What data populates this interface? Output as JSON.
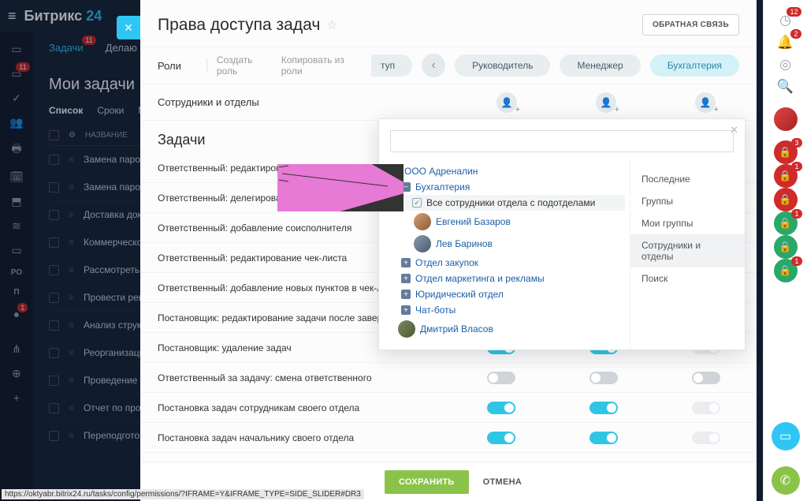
{
  "bg": {
    "logo1": "Битрикс",
    "logo2": "24",
    "tabs": [
      {
        "label": "Задачи",
        "badge": "11"
      },
      {
        "label": "Делаю"
      }
    ],
    "title": "Мои задачи",
    "filters": [
      "Список",
      "Сроки",
      "Мой"
    ],
    "head_col": "НАЗВАНИЕ",
    "rows": [
      "Замена парол",
      "Замена парол",
      "Доставка доку",
      "Коммерческое",
      "Рассмотреть",
      "Провести рев",
      "Анализ структ",
      "Реорганизаци",
      "Проведение о",
      "Отчет по прод",
      "Переподготов"
    ],
    "left_icons": [
      {
        "g": "▭",
        "b": ""
      },
      {
        "g": "▭",
        "b": "11"
      },
      {
        "g": "✓",
        "b": ""
      },
      {
        "g": "👥",
        "b": ""
      },
      {
        "g": "🖶",
        "b": ""
      },
      {
        "g": "🗓",
        "b": ""
      },
      {
        "g": "⬒",
        "b": ""
      },
      {
        "g": "≋",
        "b": ""
      },
      {
        "g": "▭",
        "b": ""
      },
      {
        "t": "PO"
      },
      {
        "t": "П"
      },
      {
        "g": "●",
        "b": "1"
      },
      {
        "g": "",
        "b": ""
      },
      {
        "g": "⋔",
        "b": ""
      },
      {
        "g": "⊕",
        "b": ""
      },
      {
        "g": "+",
        "b": ""
      }
    ],
    "url": "https://oktyabr.bitrix24.ru/tasks/config/permissions/?IFRAME=Y&IFRAME_TYPE=SIDE_SLIDER#DR3"
  },
  "panel": {
    "title": "Права доступа задач",
    "feedback": "ОБРАТНАЯ СВЯЗЬ",
    "roles_label": "Роли",
    "create_role": "Создать роль",
    "copy_role": "Копировать из роли",
    "role_half": "туп",
    "roles": [
      "Руководитель",
      "Менеджер",
      "Бухгалтерия"
    ],
    "employees_label": "Сотрудники и отделы",
    "section": "Задачи",
    "perm_rows": [
      {
        "n": "Ответственный: редактирование задачи",
        "t": []
      },
      {
        "n": "Ответственный: делегирование",
        "t": []
      },
      {
        "n": "Ответственный: добавление соисполнителя",
        "t": []
      },
      {
        "n": "Ответственный: редактирование чек-листа",
        "t": []
      },
      {
        "n": "Ответственный: добавление новых пунктов в чек-листы",
        "t": []
      },
      {
        "n": "Постановщик: редактирование задачи после заверше...",
        "t": []
      },
      {
        "n": "Постановщик: удаление задач",
        "t": [
          "on",
          "on",
          "dis"
        ]
      },
      {
        "n": "Ответственный за задачу: смена ответственного",
        "t": [
          "off",
          "off",
          "off"
        ]
      },
      {
        "n": "Постановка задач сотрудникам своего отдела",
        "t": [
          "on",
          "on",
          "dis"
        ]
      },
      {
        "n": "Постановка задач начальнику своего отдела",
        "t": [
          "on",
          "on",
          "dis"
        ]
      }
    ],
    "save": "СОХРАНИТЬ",
    "cancel": "ОТМЕНА"
  },
  "popup": {
    "root": "ООО Адреналин",
    "dept": "Бухгалтерия",
    "all_sub": "Все сотрудники отдела с подотделами",
    "people": [
      "Евгений Базаров",
      "Лев Баринов"
    ],
    "other_depts": [
      "Отдел закупок",
      "Отдел маркетинга и рекламы",
      "Юридический отдел",
      "Чат-боты"
    ],
    "loose_person": "Дмитрий Власов",
    "tabs": [
      "Последние",
      "Группы",
      "Мои группы",
      "Сотрудники и отделы",
      "Поиск"
    ]
  },
  "rsb": {
    "icons": [
      {
        "g": "◷",
        "b": "12"
      },
      {
        "g": "🔔",
        "b": "2"
      },
      {
        "g": "◎",
        "b": ""
      },
      {
        "g": "🔍",
        "b": ""
      }
    ],
    "locks": [
      {
        "c": "#d02a2a",
        "b": "3"
      },
      {
        "c": "#d02a2a",
        "b": "1"
      },
      {
        "c": "#d02a2a",
        "b": ""
      },
      {
        "c": "#2aa86a",
        "b": "1"
      },
      {
        "c": "#2aa86a",
        "b": ""
      },
      {
        "c": "#2aa86a",
        "b": "1"
      }
    ]
  }
}
